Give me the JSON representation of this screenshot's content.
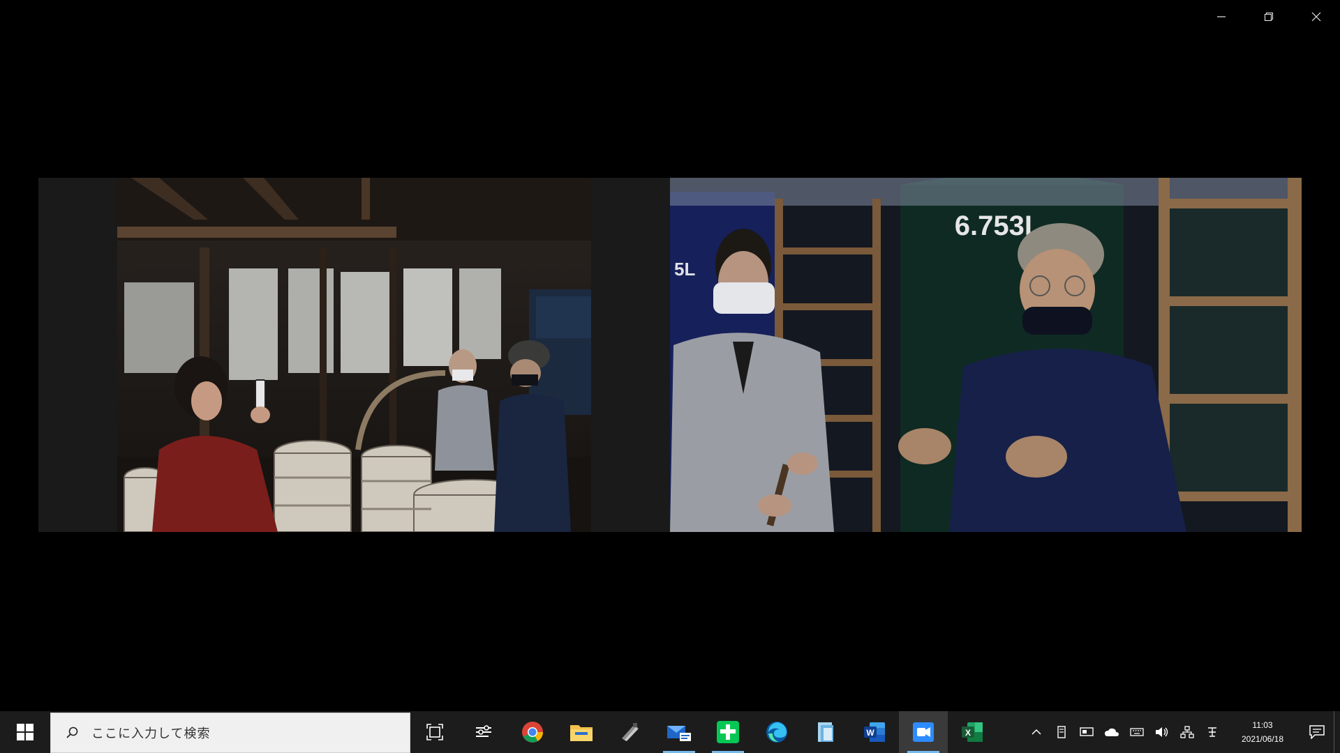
{
  "window": {
    "title": "",
    "controls": {
      "minimize_icon": "minimize-icon",
      "restore_icon": "restore-icon",
      "close_icon": "close-icon"
    }
  },
  "video_tiles": [
    {
      "scene": "barrel-cellar",
      "participants_visible": 4
    },
    {
      "scene": "sake-tank-room",
      "participants_visible": 2,
      "tank_label": "6.753L"
    }
  ],
  "taskbar": {
    "search_placeholder": "ここに入力して検索",
    "pinned_apps": [
      {
        "name": "task-view",
        "icon": "task-view-icon",
        "running": false
      },
      {
        "name": "widgets",
        "icon": "widgets-icon",
        "running": false
      },
      {
        "name": "chrome",
        "icon": "chrome-icon",
        "running": false
      },
      {
        "name": "file-explorer",
        "icon": "folder-icon",
        "running": false
      },
      {
        "name": "app-5",
        "icon": "generic-app-icon",
        "running": false
      },
      {
        "name": "mail",
        "icon": "mail-icon",
        "running": true
      },
      {
        "name": "line",
        "icon": "line-icon",
        "running": true
      },
      {
        "name": "edge",
        "icon": "edge-icon",
        "running": false
      },
      {
        "name": "app-9",
        "icon": "document-icon",
        "running": false
      },
      {
        "name": "word",
        "icon": "word-icon",
        "running": false
      },
      {
        "name": "zoom",
        "icon": "video-meeting-icon",
        "running": true,
        "active": true
      },
      {
        "name": "excel",
        "icon": "excel-icon",
        "running": false
      }
    ],
    "tray_icons": [
      "chevron-up-icon",
      "app-tray-icon",
      "display-icon",
      "cloud-icon",
      "keyboard-icon",
      "speaker-icon",
      "network-icon",
      "ime-icon"
    ],
    "clock": {
      "time": "11:03",
      "date": "2021/06/18"
    },
    "colors": {
      "taskbar_bg": "#1c1c1c",
      "search_bg": "#f0f0f0",
      "running_indicator": "#76b9ed"
    }
  }
}
